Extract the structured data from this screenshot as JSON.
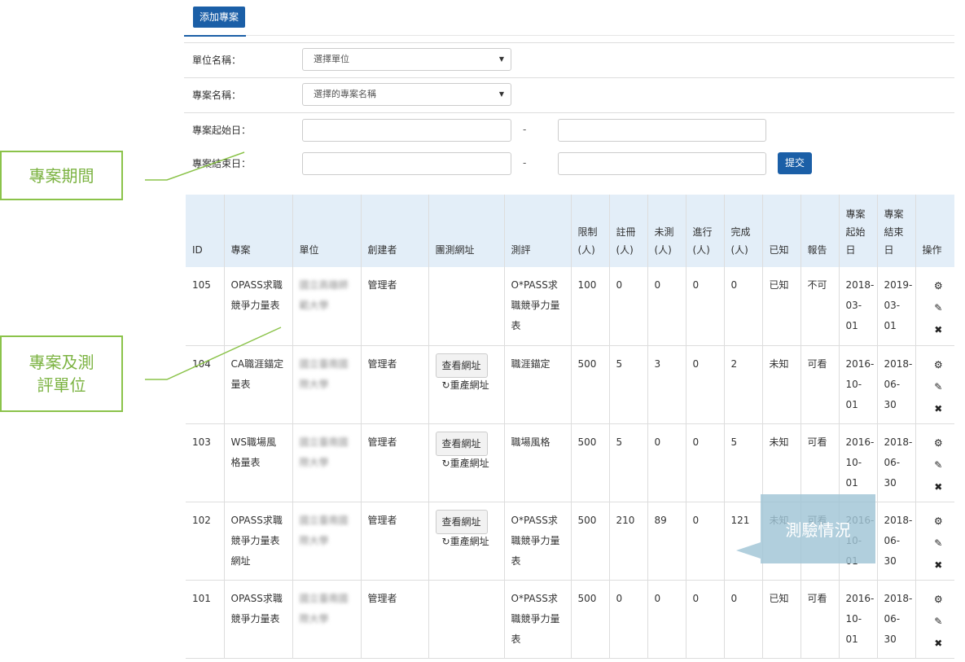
{
  "toolbar": {
    "add_label": "添加專案"
  },
  "filters": {
    "unit_label": "單位名稱：",
    "unit_value": "選擇單位",
    "project_label": "專案名稱：",
    "project_value": "選擇的專案名稱",
    "start_label": "專案起始日：",
    "end_label": "專案結束日：",
    "dash": "-",
    "submit_label": "提交"
  },
  "table": {
    "headers": [
      "ID",
      "專案",
      "單位",
      "創建者",
      "團測網址",
      "測評",
      "限制(人)",
      "註冊(人)",
      "未測(人)",
      "進行(人)",
      "完成(人)",
      "已知",
      "報告",
      "專案起始日",
      "專案結束日",
      "操作"
    ],
    "rows": [
      {
        "id": "105",
        "project": "OPASS求職競爭力量表",
        "unit": "國立高雄師範大學",
        "creator": "管理者",
        "url": "",
        "regen": "",
        "assessment": "O*PASS求職競爭力量表",
        "limit": "100",
        "registered": "0",
        "untested": "0",
        "inprogress": "0",
        "completed": "0",
        "known": "已知",
        "report": "不可",
        "start": "2018-03-01",
        "end": "2019-03-01"
      },
      {
        "id": "104",
        "project": "CA職涯錨定量表",
        "unit": "國立臺南國際大學",
        "creator": "管理者",
        "url": "查看網址",
        "regen": "重產網址",
        "assessment": "職涯錨定",
        "limit": "500",
        "registered": "5",
        "untested": "3",
        "inprogress": "0",
        "completed": "2",
        "known": "未知",
        "report": "可看",
        "start": "2016-10-01",
        "end": "2018-06-30"
      },
      {
        "id": "103",
        "project": "WS職場風格量表",
        "unit": "國立臺南國際大學",
        "creator": "管理者",
        "url": "查看網址",
        "regen": "重產網址",
        "assessment": "職場風格",
        "limit": "500",
        "registered": "5",
        "untested": "0",
        "inprogress": "0",
        "completed": "5",
        "known": "未知",
        "report": "可看",
        "start": "2016-10-01",
        "end": "2018-06-30"
      },
      {
        "id": "102",
        "project": "OPASS求職競爭力量表網址",
        "unit": "國立臺南國際大學",
        "creator": "管理者",
        "url": "查看網址",
        "regen": "重產網址",
        "assessment": "O*PASS求職競爭力量表",
        "limit": "500",
        "registered": "210",
        "untested": "89",
        "inprogress": "0",
        "completed": "121",
        "known": "未知",
        "report": "可看",
        "start": "2016-10-01",
        "end": "2018-06-30"
      },
      {
        "id": "101",
        "project": "OPASS求職競爭力量表",
        "unit": "國立臺南國際大學",
        "creator": "管理者",
        "url": "",
        "regen": "",
        "assessment": "O*PASS求職競爭力量表",
        "limit": "500",
        "registered": "0",
        "untested": "0",
        "inprogress": "0",
        "completed": "0",
        "known": "已知",
        "report": "可看",
        "start": "2016-10-01",
        "end": "2018-06-30"
      }
    ]
  },
  "annotations": {
    "period": "專案期間",
    "units_line1": "專案及測",
    "units_line2": "評單位",
    "status": "測驗情況"
  },
  "colors": {
    "primary": "#1b5fa7",
    "header_bg": "#e3eef8",
    "callout": "#8bc34a",
    "tooltip": "#a0c4d6"
  },
  "icons": {
    "settings": "gear-icon",
    "edit": "edit-icon",
    "delete": "close-icon",
    "regen": "refresh-icon",
    "dropdown": "chevron-down-icon"
  }
}
